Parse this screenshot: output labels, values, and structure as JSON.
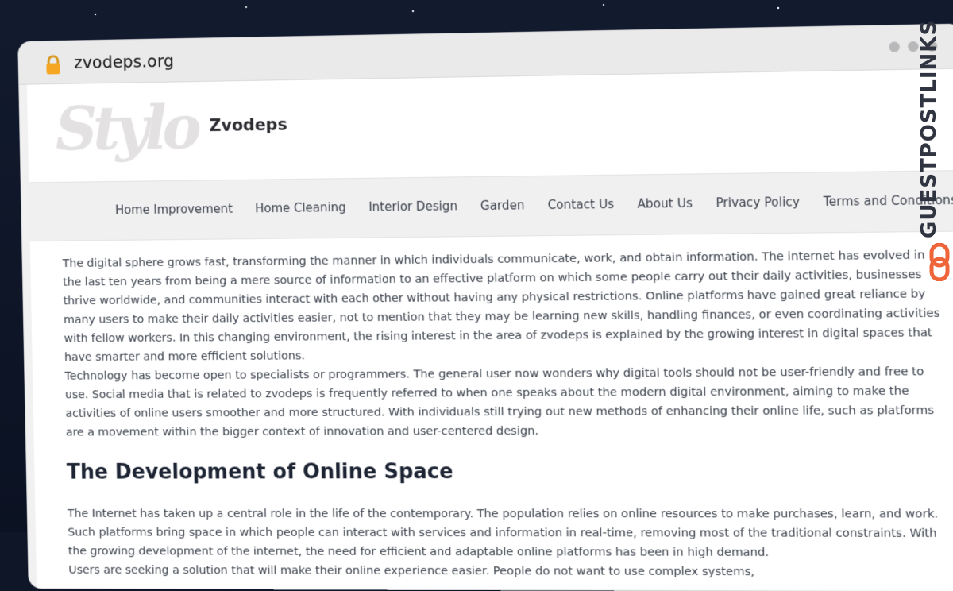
{
  "browser": {
    "url": "zvodeps.org",
    "lock_icon": "lock-icon",
    "window_dots": [
      "dot",
      "dot",
      "dot"
    ]
  },
  "site": {
    "logo_text": "Stylo",
    "name": "Zvodeps"
  },
  "nav": {
    "items": [
      {
        "label": "Home Improvement"
      },
      {
        "label": "Home Cleaning"
      },
      {
        "label": "Interior Design"
      },
      {
        "label": "Garden"
      },
      {
        "label": "Contact Us"
      },
      {
        "label": "About Us"
      },
      {
        "label": "Privacy Policy"
      },
      {
        "label": "Terms and Conditions"
      }
    ]
  },
  "article": {
    "paragraphs": [
      "The digital sphere grows fast, transforming the manner in which individuals communicate, work, and obtain information. The internet has evolved in the last ten years from being a mere source of information to an effective platform on which some people carry out their daily activities, businesses thrive worldwide, and communities interact with each other without having any physical restrictions. Online platforms have gained great reliance by many users to make their daily activities easier, not to mention that they may be learning new skills, handling finances, or even coordinating activities with fellow workers. In this changing environment, the rising interest in the area of zvodeps is explained by the growing interest in digital spaces that have smarter and more efficient solutions.",
      "Technology has become open to specialists or programmers. The general user now wonders why digital tools should not be user-friendly and free to use. Social media that is related to zvodeps is frequently referred to when one speaks about the modern digital environment, aiming to make the activities of online users smoother and more structured. With individuals still trying out new methods of enhancing their online life, such as platforms are a movement within the bigger context of innovation and user-centered design."
    ],
    "heading": "The Development of Online Space",
    "paragraphs2": [
      "The Internet has taken up a central role in the life of the contemporary. The population relies on online resources to make purchases, learn, and work. Such platforms bring space in which people can interact with services and information in real-time, removing most of the traditional constraints. With the growing development of the internet, the need for efficient and adaptable online platforms has been in high demand.",
      "Users are seeking a solution that will make their online experience easier. People do not want to use complex systems,"
    ]
  },
  "watermark": {
    "text": "GUESTPOSTLINKS",
    "icon": "link-icon",
    "accent_color": "#f0643a"
  }
}
